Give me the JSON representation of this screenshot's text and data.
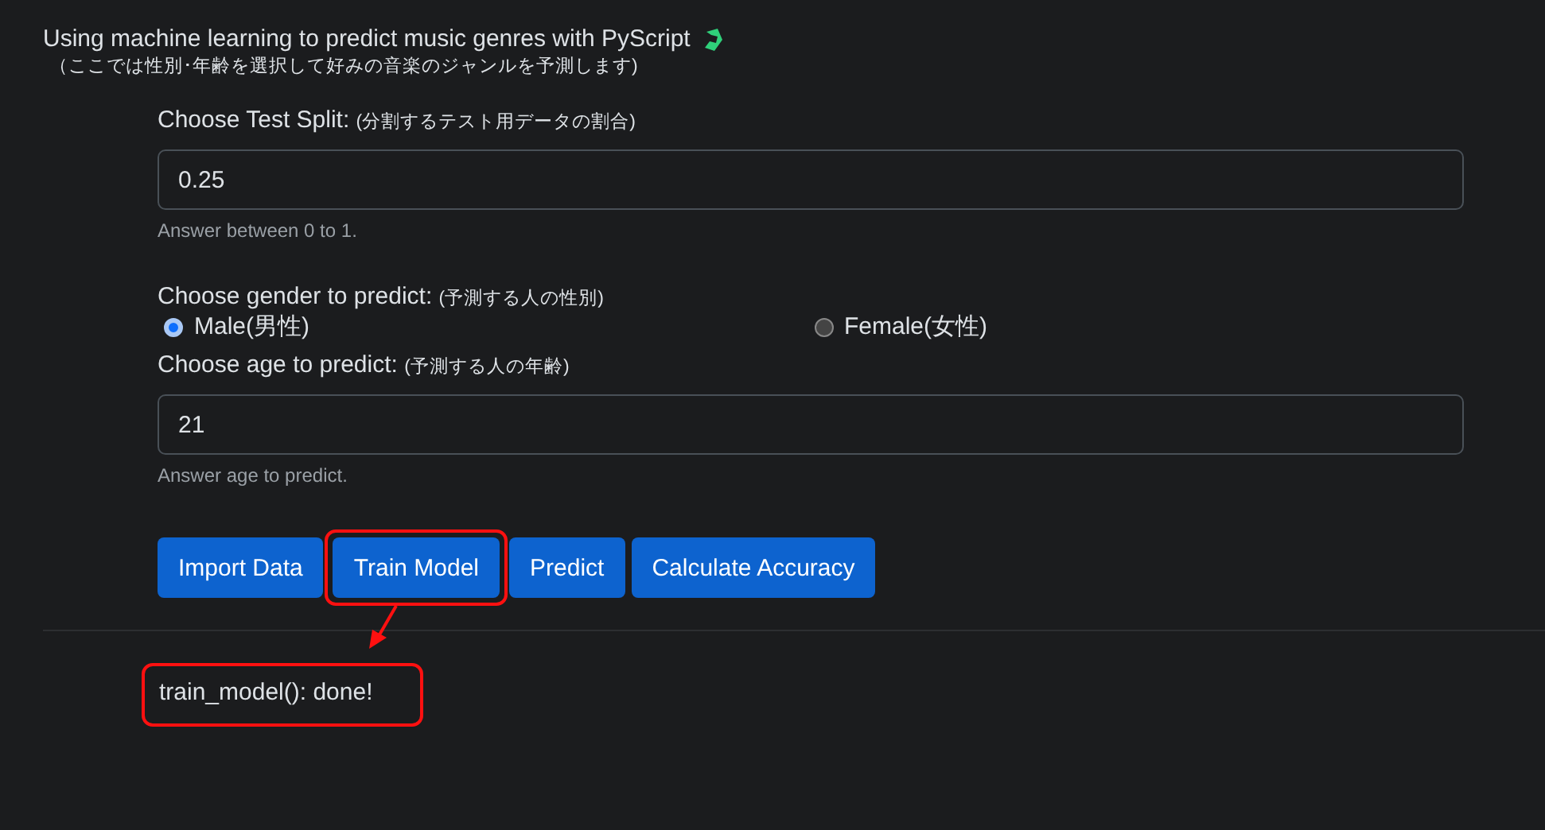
{
  "header": {
    "title": "Using machine learning to predict music genres with PyScript",
    "subtitle": "（ここでは性別･年齢を選択して好みの音楽のジャンルを予測します)"
  },
  "test_split": {
    "label": "Choose Test Split:",
    "label_note": "(分割するテスト用データの割合)",
    "value": "0.25",
    "hint": "Answer between 0 to 1."
  },
  "gender": {
    "label": "Choose gender to predict:",
    "label_note": "(予測する人の性別)",
    "options": [
      {
        "label": "Male(男性)",
        "selected": true
      },
      {
        "label": "Female(女性)",
        "selected": false
      }
    ]
  },
  "age": {
    "label": "Choose age to predict:",
    "label_note": "(予測する人の年齢)",
    "value": "21",
    "hint": "Answer age to predict."
  },
  "buttons": [
    {
      "label": "Import Data",
      "highlighted": false
    },
    {
      "label": "Train Model",
      "highlighted": true
    },
    {
      "label": "Predict",
      "highlighted": false
    },
    {
      "label": "Calculate Accuracy",
      "highlighted": false
    }
  ],
  "output": {
    "text": "train_model(): done!",
    "highlighted": true
  }
}
